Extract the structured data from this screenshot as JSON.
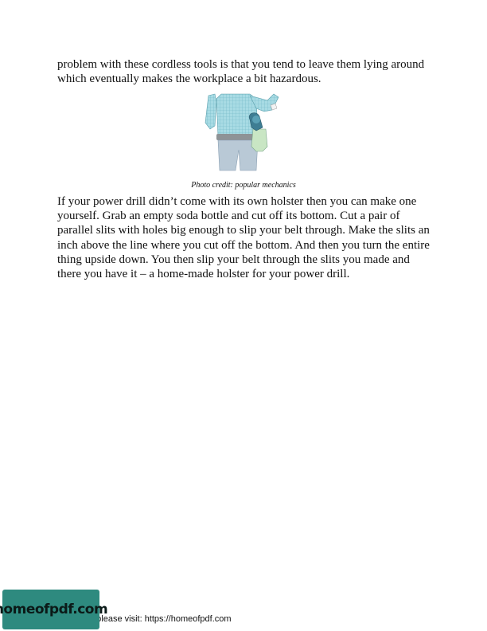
{
  "paragraphs": {
    "p1": "problem with these cordless tools is that you tend to leave them lying around which eventually makes the workplace a bit hazardous.",
    "p2": "If your power drill didn’t come with its own holster then you can make one yourself. Grab an empty soda bottle and cut off its bottom. Cut a pair of parallel slits with holes big enough to slip your belt through. Make the slits an inch above the line where you cut off the bottom. And then you turn the entire thing upside down. You then slip your belt through the slits you made and there you have it – a home-made holster for your power drill."
  },
  "figure": {
    "caption": "Photo credit: popular mechanics",
    "colors": {
      "shirt": "#9fd6e0",
      "belt": "#8e9396",
      "jeans": "#b9c9d6",
      "drill": "#3e7d93",
      "bottle": "#c9e6c4"
    }
  },
  "footer": {
    "badge": "homeofpdf.com",
    "text": "e please visit: https://homeofpdf.com"
  }
}
